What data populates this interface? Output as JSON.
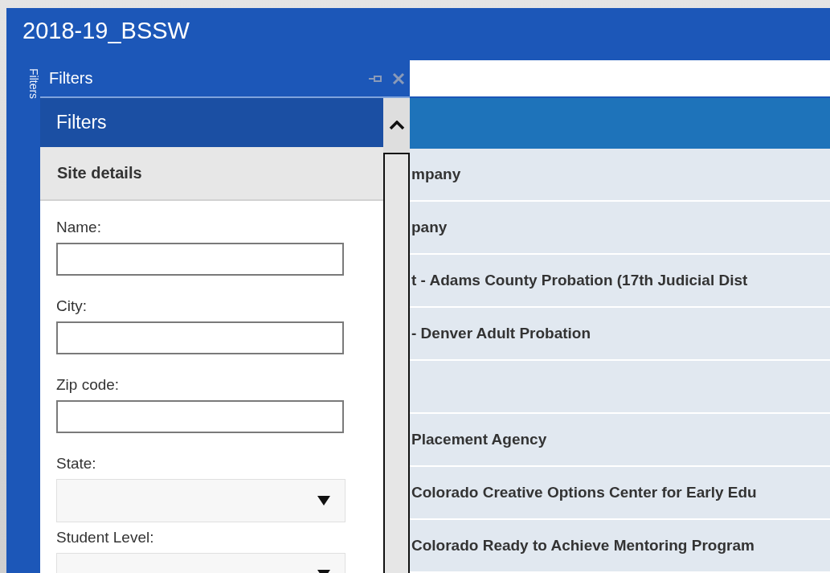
{
  "window": {
    "title": "2018-19_BSSW"
  },
  "side_tab": {
    "label": "Filters"
  },
  "filter_pane": {
    "title": "Filters",
    "panel_title": "Filters",
    "section": "Site details",
    "fields": [
      {
        "label": "Name:",
        "kind": "text"
      },
      {
        "label": "City:",
        "kind": "text"
      },
      {
        "label": "Zip code:",
        "kind": "text"
      },
      {
        "label": "State:",
        "kind": "dropdown"
      },
      {
        "label": "Student Level:",
        "kind": "dropdown"
      }
    ]
  },
  "table": {
    "rows": [
      {
        "cell": "mpany"
      },
      {
        "cell": "pany"
      },
      {
        "cell": "t - Adams County Probation (17th Judicial Dist"
      },
      {
        "cell": "- Denver Adult Probation"
      },
      {},
      {
        "cell": "Placement Agency"
      },
      {
        "cell": "Colorado Creative Options Center for Early Edu"
      },
      {
        "cell": "Colorado Ready to Achieve Mentoring Program"
      }
    ]
  }
}
